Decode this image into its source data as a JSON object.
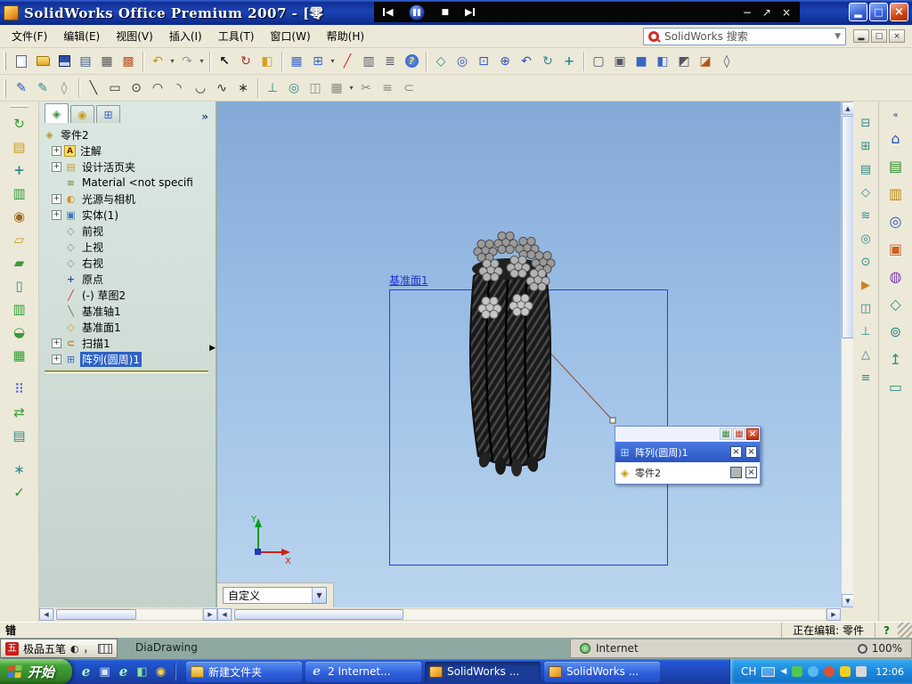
{
  "window": {
    "title": "SolidWorks Office Premium 2007 - [零",
    "controls": [
      "minimize",
      "maximize",
      "close"
    ]
  },
  "media_overlay": {
    "controls": [
      "previous",
      "pause",
      "stop",
      "next"
    ],
    "window_controls": [
      "minimize",
      "restore",
      "close"
    ]
  },
  "menubar": {
    "items": [
      "文件(F)",
      "编辑(E)",
      "视图(V)",
      "插入(I)",
      "工具(T)",
      "窗口(W)",
      "帮助(H)"
    ],
    "search_label": "SolidWorks 搜索",
    "mdi_controls": [
      "minimize",
      "restore",
      "close"
    ]
  },
  "toolbars": {
    "standard_icons": [
      "new",
      "open",
      "save",
      "save-as",
      "print",
      "color-swatches",
      "undo",
      "redo",
      "select",
      "rebuild",
      "edit-color",
      "grid",
      "insert-object",
      "sketch-edit",
      "table",
      "list",
      "help",
      "view-orientation",
      "zoom-to-fit",
      "zoom-to-area",
      "zoom-in-out",
      "zoom-previous",
      "rotate-view",
      "pan",
      "wireframe",
      "hidden-lines-visible",
      "shaded",
      "shaded-with-edges",
      "shadows",
      "section-view",
      "perspective"
    ],
    "sketch_icons": [
      "sketch",
      "3d-sketch",
      "grid-options",
      "line",
      "rectangle",
      "circle",
      "centerpoint-arc",
      "tangent-arc",
      "3-point-arc",
      "spline",
      "point",
      "add-relation",
      "display-relations",
      "mirror-entities",
      "linear-sketch-pattern",
      "trim-entities",
      "offset-entities",
      "convert-entities"
    ],
    "features_icons": [
      "extruded-boss",
      "revolved-boss",
      "swept-boss",
      "lofted-boss",
      "extruded-cut",
      "revolved-cut",
      "swept-cut",
      "fillet",
      "chamfer",
      "shell",
      "rib",
      "linear-pattern",
      "mirror",
      "reference-geometry",
      "curves",
      "instant-3d"
    ]
  },
  "feature_tree": {
    "tabs": [
      "feature-manager",
      "property-manager",
      "configuration-manager"
    ],
    "overflow_chevron": "»",
    "items": [
      {
        "label": "零件2",
        "icon": "part"
      },
      {
        "label": "注解",
        "icon": "annotations",
        "expand": "+"
      },
      {
        "label": "设计活页夹",
        "icon": "design-binder",
        "expand": "+"
      },
      {
        "label": "Material <not specifi",
        "icon": "material"
      },
      {
        "label": "光源与相机",
        "icon": "lights-and-cameras",
        "expand": "+"
      },
      {
        "label": "实体(1)",
        "icon": "solid-bodies-folder",
        "expand": "+"
      },
      {
        "label": "前视",
        "icon": "plane"
      },
      {
        "label": "上视",
        "icon": "plane"
      },
      {
        "label": "右视",
        "icon": "plane"
      },
      {
        "label": "原点",
        "icon": "origin"
      },
      {
        "label": "(-) 草图2",
        "icon": "sketch"
      },
      {
        "label": "基准轴1",
        "icon": "axis"
      },
      {
        "label": "基准面1",
        "icon": "reference-plane"
      },
      {
        "label": "扫描1",
        "icon": "sweep",
        "expand": "+"
      },
      {
        "label": "阵列(圆周)1",
        "icon": "circular-pattern",
        "expand": "+",
        "selected": true
      }
    ]
  },
  "viewport": {
    "plane_label": "基准面1",
    "combo_value": "自定义",
    "triad": {
      "x": "X",
      "y": "Y"
    },
    "popup": {
      "header_icons": [
        "grid-green",
        "grid-red",
        "close"
      ],
      "rows": [
        {
          "label": "阵列(圆周)1",
          "selected": true,
          "checkboxes": [
            "x",
            "x"
          ]
        },
        {
          "label": "零件2",
          "checkboxes": [
            "disabled",
            "x"
          ]
        }
      ]
    }
  },
  "right_panels": {
    "column_icons": [
      "view-tool-1",
      "view-tool-2",
      "view-tool-3",
      "view-tool-4",
      "view-tool-5",
      "view-tool-6",
      "view-tool-7",
      "view-tool-8",
      "view-tool-9",
      "view-tool-10",
      "view-tool-11",
      "view-tool-12"
    ],
    "task_pane_icons": [
      "collapse",
      "solidworks-resources",
      "design-library",
      "file-explorer",
      "search",
      "view-palette",
      "appearances",
      "custom-properties",
      "document-recovery",
      "scene",
      "up"
    ]
  },
  "statusbar": {
    "left": "错",
    "editing": "正在编辑: 零件",
    "help": "?"
  },
  "background": {
    "ime_label": "极品五笔",
    "window_text": "DiaDrawing",
    "internet_label": "Internet",
    "zoom_label": "100%"
  },
  "taskbar": {
    "start_label": "开始",
    "tasks": [
      {
        "label": "新建文件夹",
        "icon": "folder"
      },
      {
        "label": "2 Internet...",
        "icon": "internet-explorer"
      },
      {
        "label": "SolidWorks ...",
        "icon": "solidworks",
        "active": true
      },
      {
        "label": "SolidWorks ...",
        "icon": "solidworks"
      }
    ],
    "tray": {
      "lang": "CH",
      "time": "12:06"
    }
  }
}
